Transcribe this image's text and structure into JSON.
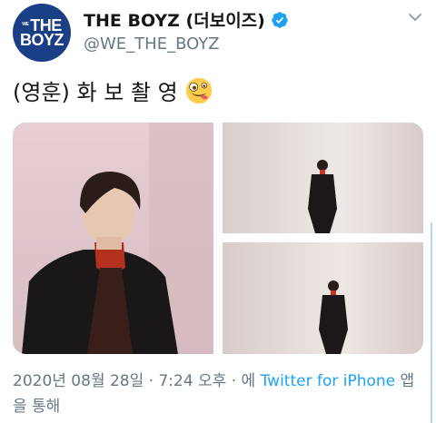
{
  "account": {
    "avatar_text_top": "THE",
    "avatar_text_mini": "WE",
    "avatar_text_bottom": "BOYZ",
    "display_name": "THE BOYZ (더보이즈)",
    "handle": "@WE_THE_BOYZ",
    "verified_icon": "verified-badge-icon",
    "menu_icon": "chevron-down-icon"
  },
  "tweet": {
    "text": "(영훈) 화 보 촬 영",
    "emoji": "zany-face-emoji"
  },
  "media": {
    "count": 3,
    "layout": "one-large-left-two-stacked-right"
  },
  "footer": {
    "timestamp": "2020년 08월 28일 · 7:24 오후 · 에 ",
    "source_link": "Twitter for iPhone",
    "suffix": " 앱을 통해"
  },
  "colors": {
    "text": "#14171a",
    "secondary": "#657786",
    "link": "#1da1f2",
    "avatar_bg": "#1b3f86"
  }
}
